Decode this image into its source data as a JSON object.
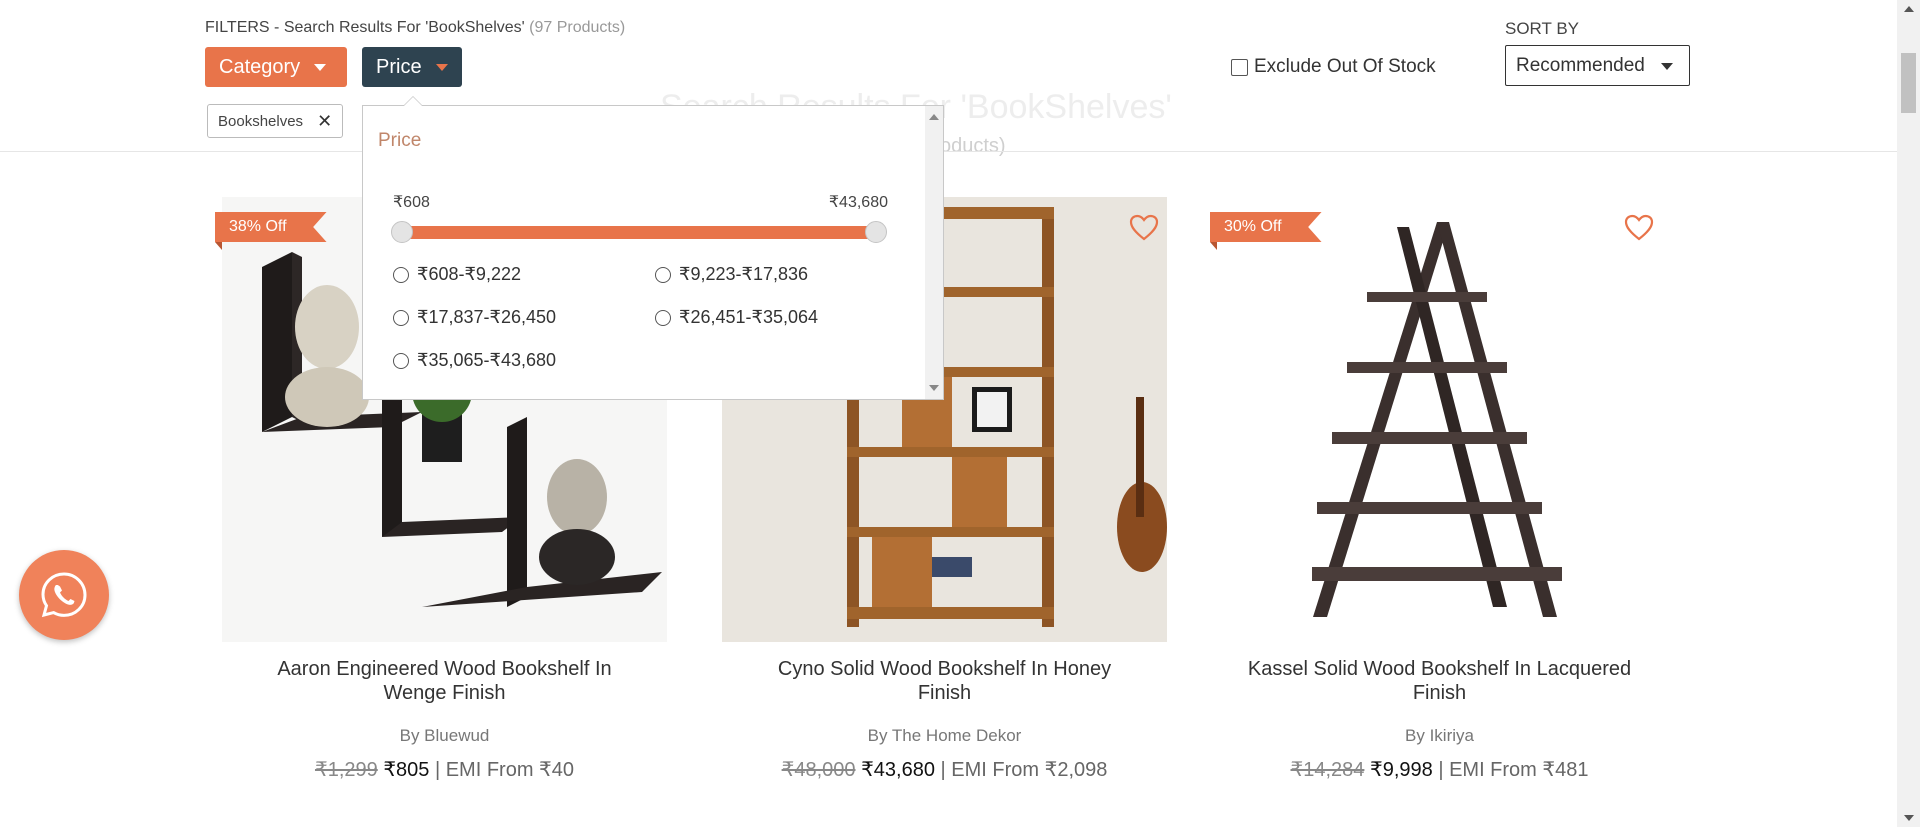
{
  "header": {
    "filters_text": "FILTERS - Search Results For 'BookShelves'",
    "product_count": "(97 Products)",
    "category_label": "Category",
    "price_label": "Price",
    "active_chip": "Bookshelves",
    "chip_remove": "✕",
    "exclude_label": "Exclude Out Of Stock",
    "sort_label": "SORT BY",
    "sort_value": "Recommended"
  },
  "background": {
    "title": "Search Results For 'BookShelves'",
    "subtitle": "Products)"
  },
  "price_filter": {
    "title": "Price",
    "min": "₹608",
    "max": "₹43,680",
    "options": [
      "₹608-₹9,222",
      "₹9,223-₹17,836",
      "₹17,837-₹26,450",
      "₹26,451-₹35,064",
      "₹35,065-₹43,680"
    ]
  },
  "products": [
    {
      "badge": "38% Off",
      "name_line1": "Aaron Engineered Wood Bookshelf In",
      "name_line2": "Wenge Finish",
      "by": "By Bluewud",
      "old_price": "₹1,299",
      "price": "₹805",
      "emi": "| EMI From ₹40"
    },
    {
      "badge": "",
      "name_line1": "Cyno Solid Wood Bookshelf In Honey",
      "name_line2": "Finish",
      "by": "By The Home Dekor",
      "old_price": "₹48,000",
      "price": "₹43,680",
      "emi": "| EMI From ₹2,098"
    },
    {
      "badge": "30% Off",
      "name_line1": "Kassel Solid Wood Bookshelf In Lacquered",
      "name_line2": "Finish",
      "by": "By Ikiriya",
      "old_price": "₹14,284",
      "price": "₹9,998",
      "emi": "| EMI From ₹481"
    }
  ],
  "colors": {
    "accent": "#e8744a",
    "dark": "#2e4350"
  },
  "icons": {
    "wishlist": "heart-icon",
    "chat": "whatsapp-icon"
  }
}
